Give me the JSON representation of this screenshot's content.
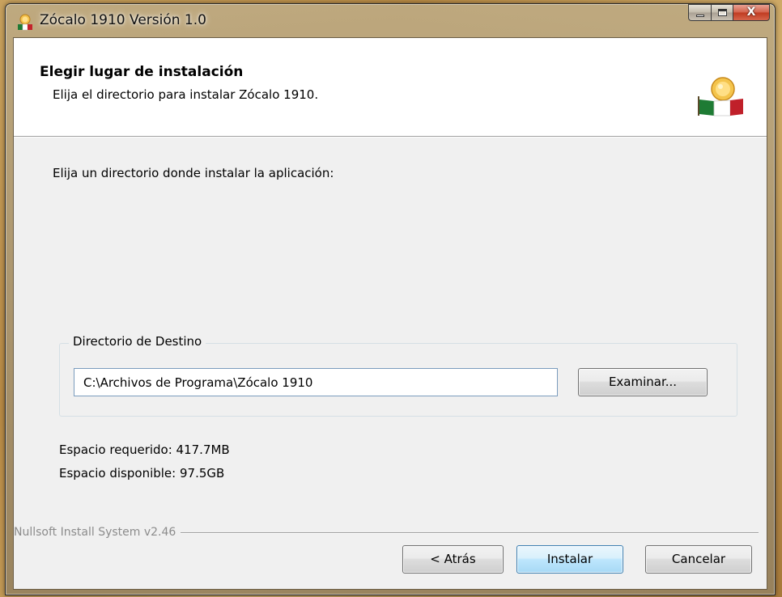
{
  "window": {
    "title": "Zócalo 1910 Versión 1.0",
    "close_glyph": "X"
  },
  "header": {
    "title": "Elegir lugar de instalación",
    "subtitle": "Elija el directorio para instalar Zócalo 1910."
  },
  "body": {
    "instruction": "Elija un directorio donde instalar la aplicación:",
    "group_label": "Directorio de Destino",
    "directory_value": "C:\\Archivos de Programa\\Zócalo 1910",
    "browse_label": "Examinar...",
    "space_required": "Espacio requerido: 417.7MB",
    "space_available": "Espacio disponible: 97.5GB"
  },
  "footer": {
    "branding": "Nullsoft Install System v2.46",
    "back_label": "< Atrás",
    "install_label": "Instalar",
    "cancel_label": "Cancelar"
  },
  "icons": {
    "app": "zocalo-app-icon",
    "header": "zocalo-header-icon"
  },
  "colors": {
    "default_button_border": "#3c7fb1",
    "close_button": "#c03b21",
    "branding_text": "#8c8c8c"
  }
}
